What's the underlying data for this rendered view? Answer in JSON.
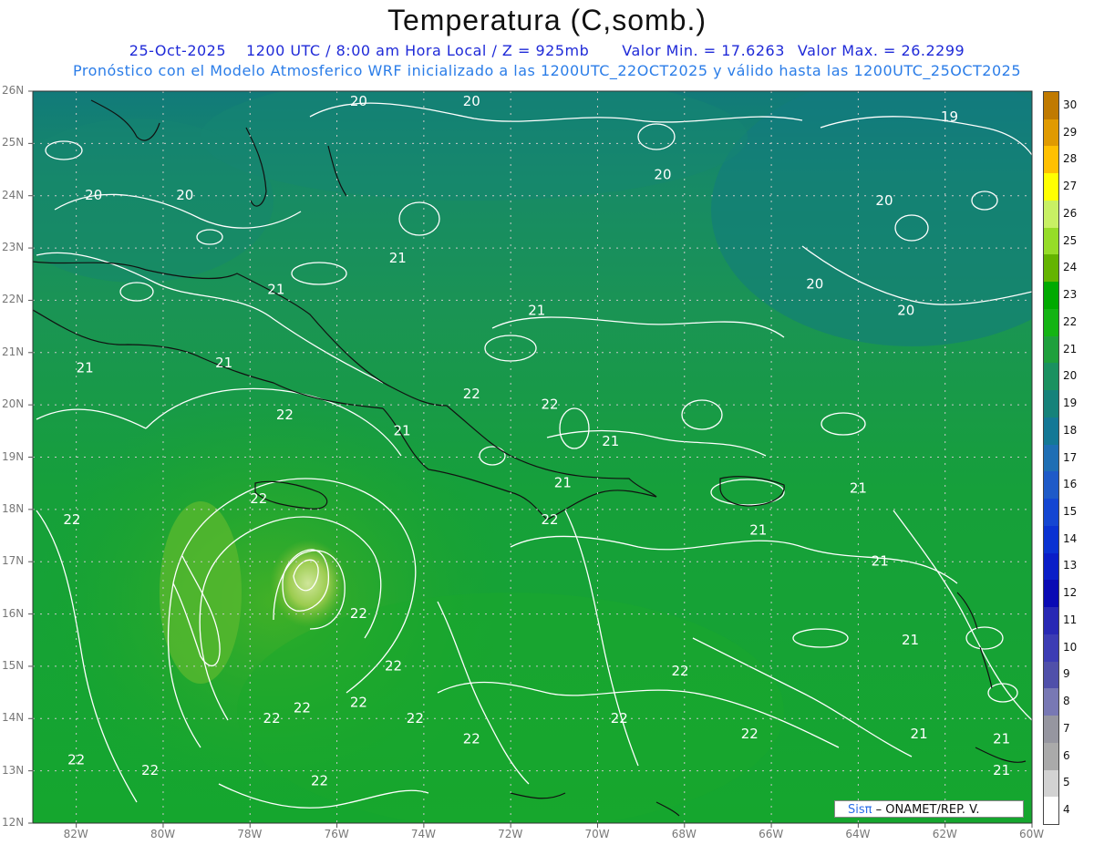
{
  "title": "Temperatura (C,somb.)",
  "subtitle": {
    "date": "25-Oct-2025",
    "time": "1200 UTC / 8:00 am Hora Local / Z = 925mb",
    "min": "Valor Min. = 17.6263",
    "max": "Valor Max. = 26.2299"
  },
  "forecast_line": "Pronóstico con el Modelo Atmosferico WRF inicializado a las 1200UTC_22OCT2025 y válido hasta las  1200UTC_25OCT2025",
  "credit": {
    "sis": "Sisπ",
    "rest": "– ONAMET/REP.  V."
  },
  "map": {
    "lon_range": [
      -83,
      -60
    ],
    "lat_range": [
      12,
      26
    ],
    "lon_labels": [
      "82W",
      "80W",
      "78W",
      "76W",
      "74W",
      "72W",
      "70W",
      "68W",
      "66W",
      "64W",
      "62W",
      "60W"
    ],
    "lat_labels": [
      "26N",
      "25N",
      "24N",
      "23N",
      "22N",
      "21N",
      "20N",
      "19N",
      "18N",
      "17N",
      "16N",
      "15N",
      "14N",
      "13N",
      "12N"
    ],
    "contour_labels": [
      {
        "text": "20",
        "lon": -75.5,
        "lat": 25.8
      },
      {
        "text": "20",
        "lon": -72.9,
        "lat": 25.8
      },
      {
        "text": "19",
        "lon": -61.9,
        "lat": 25.5
      },
      {
        "text": "20",
        "lon": -68.5,
        "lat": 24.4
      },
      {
        "text": "20",
        "lon": -81.6,
        "lat": 24.0
      },
      {
        "text": "20",
        "lon": -79.5,
        "lat": 24.0
      },
      {
        "text": "20",
        "lon": -63.4,
        "lat": 23.9
      },
      {
        "text": "21",
        "lon": -74.6,
        "lat": 22.8
      },
      {
        "text": "21",
        "lon": -77.4,
        "lat": 22.2
      },
      {
        "text": "20",
        "lon": -65.0,
        "lat": 22.3
      },
      {
        "text": "20",
        "lon": -62.9,
        "lat": 21.8
      },
      {
        "text": "21",
        "lon": -71.4,
        "lat": 21.8
      },
      {
        "text": "21",
        "lon": -81.8,
        "lat": 20.7
      },
      {
        "text": "21",
        "lon": -78.6,
        "lat": 20.8
      },
      {
        "text": "22",
        "lon": -72.9,
        "lat": 20.2
      },
      {
        "text": "22",
        "lon": -71.1,
        "lat": 20.0
      },
      {
        "text": "22",
        "lon": -77.2,
        "lat": 19.8
      },
      {
        "text": "21",
        "lon": -74.5,
        "lat": 19.5
      },
      {
        "text": "21",
        "lon": -69.7,
        "lat": 19.3
      },
      {
        "text": "21",
        "lon": -70.8,
        "lat": 18.5
      },
      {
        "text": "22",
        "lon": -77.8,
        "lat": 18.2
      },
      {
        "text": "21",
        "lon": -64.0,
        "lat": 18.4
      },
      {
        "text": "22",
        "lon": -82.1,
        "lat": 17.8
      },
      {
        "text": "22",
        "lon": -71.1,
        "lat": 17.8
      },
      {
        "text": "21",
        "lon": -66.3,
        "lat": 17.6
      },
      {
        "text": "21",
        "lon": -63.5,
        "lat": 17.0
      },
      {
        "text": "22",
        "lon": -75.5,
        "lat": 16.0
      },
      {
        "text": "21",
        "lon": -62.8,
        "lat": 15.5
      },
      {
        "text": "22",
        "lon": -74.7,
        "lat": 15.0
      },
      {
        "text": "22",
        "lon": -68.1,
        "lat": 14.9
      },
      {
        "text": "22",
        "lon": -75.5,
        "lat": 14.3
      },
      {
        "text": "22",
        "lon": -76.8,
        "lat": 14.2
      },
      {
        "text": "22",
        "lon": -77.5,
        "lat": 14.0
      },
      {
        "text": "22",
        "lon": -74.2,
        "lat": 14.0
      },
      {
        "text": "22",
        "lon": -69.5,
        "lat": 14.0
      },
      {
        "text": "22",
        "lon": -66.5,
        "lat": 13.7
      },
      {
        "text": "21",
        "lon": -62.6,
        "lat": 13.7
      },
      {
        "text": "22",
        "lon": -72.9,
        "lat": 13.6
      },
      {
        "text": "21",
        "lon": -60.7,
        "lat": 13.6
      },
      {
        "text": "22",
        "lon": -82.0,
        "lat": 13.2
      },
      {
        "text": "22",
        "lon": -80.3,
        "lat": 13.0
      },
      {
        "text": "21",
        "lon": -60.7,
        "lat": 13.0
      },
      {
        "text": "22",
        "lon": -76.4,
        "lat": 12.8
      }
    ]
  },
  "colorbar": {
    "labels": [
      "30",
      "29",
      "28",
      "27",
      "26",
      "25",
      "24",
      "23",
      "22",
      "21",
      "20",
      "19",
      "18",
      "17",
      "16",
      "15",
      "14",
      "13",
      "12",
      "11",
      "10",
      "9",
      "8",
      "7",
      "6",
      "5",
      "4"
    ],
    "colors": [
      "#c07a00",
      "#e09a00",
      "#ffc000",
      "#ffff00",
      "#c8f064",
      "#96dc28",
      "#64b400",
      "#00aa00",
      "#14b414",
      "#1ea03c",
      "#1a9160",
      "#16827a",
      "#147896",
      "#1e6eb4",
      "#1e5ac8",
      "#1446d2",
      "#0a32d2",
      "#0a1ec8",
      "#0a0ab4",
      "#2828b4",
      "#3c3cb4",
      "#5050aa",
      "#7878b4",
      "#9696a0",
      "#aaaaaa",
      "#d2d2d2",
      "#ffffff"
    ]
  }
}
